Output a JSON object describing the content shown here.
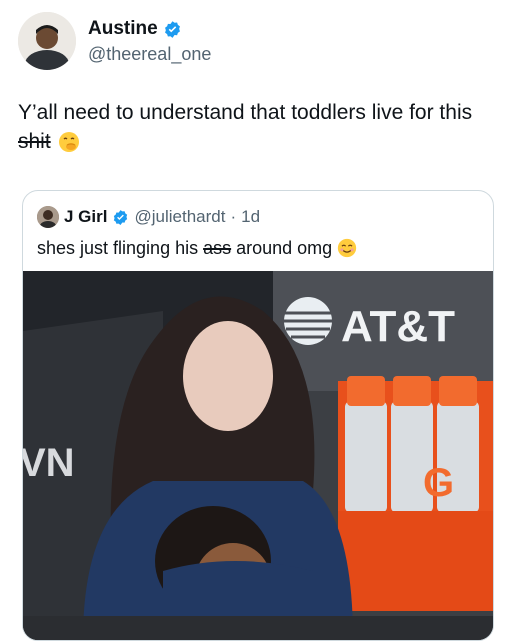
{
  "author": {
    "name": "Austine",
    "handle": "@theereal_one"
  },
  "tweet": {
    "text_before": "Y’all need to understand that toddlers live for this ",
    "text_struck": "shit"
  },
  "quoted": {
    "name": "J Girl",
    "handle": "@juliethardt",
    "separator": "·",
    "time": "1d",
    "text_before": "shes just flinging his ",
    "text_struck": "ass",
    "text_after": " around omg"
  },
  "photo": {
    "sign_text": "AT&T",
    "bottle_letter": "G",
    "left_sign": "VN"
  },
  "colors": {
    "verified": "#1d9bf0",
    "muted": "#536471",
    "gatorade": "#f0581f"
  },
  "icons": [
    "verified-badge-icon",
    "face-with-hand-over-mouth-emoji",
    "smiling-face-emoji"
  ]
}
